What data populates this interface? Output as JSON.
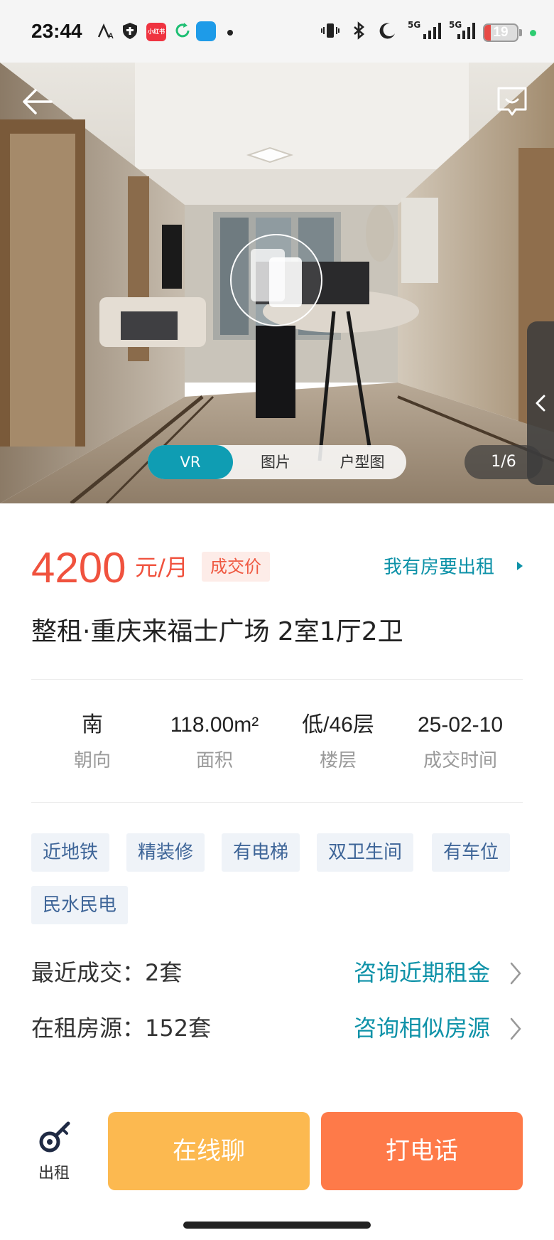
{
  "status_bar": {
    "time": "23:44",
    "battery_level": 19,
    "battery_text": "19",
    "network_1": "5G",
    "network_2": "5G",
    "red_app_text": "小红书",
    "icons": [
      "font-a-icon",
      "shield-icon",
      "red-app-icon",
      "sync-icon",
      "blue-app-icon",
      "dot-icon",
      "vibrate-icon",
      "bluetooth-icon",
      "moon-icon",
      "signal-icon",
      "signal-icon",
      "battery-icon"
    ]
  },
  "hero": {
    "tabs": [
      "VR",
      "图片",
      "户型图"
    ],
    "active_tab": "VR",
    "counter": "1/6"
  },
  "listing": {
    "price": "4200",
    "price_unit": "元/月",
    "price_tag": "成交价",
    "rent_link": "我有房要出租",
    "title": "整租·重庆来福士广场 2室1厅2卫",
    "stats": [
      {
        "value": "南",
        "label": "朝向"
      },
      {
        "value": "118.00m²",
        "label": "面积"
      },
      {
        "value": "低/46层",
        "label": "楼层"
      },
      {
        "value": "25-02-10",
        "label": "成交时间"
      }
    ],
    "tags": [
      "近地铁",
      "精装修",
      "有电梯",
      "双卫生间",
      "有车位",
      "民水民电"
    ],
    "recent_deals": {
      "label": "最近成交：2套",
      "link": "咨询近期租金"
    },
    "active_listings": {
      "label": "在租房源：152套",
      "link": "咨询相似房源"
    }
  },
  "bottom_bar": {
    "rent_label": "出租",
    "chat_label": "在线聊",
    "call_label": "打电话"
  },
  "colors": {
    "accent_teal": "#0f9db3",
    "price_red": "#f0523e",
    "chat_button": "#fcb950",
    "call_button": "#fe7a49",
    "tag_text": "#3e6598"
  }
}
